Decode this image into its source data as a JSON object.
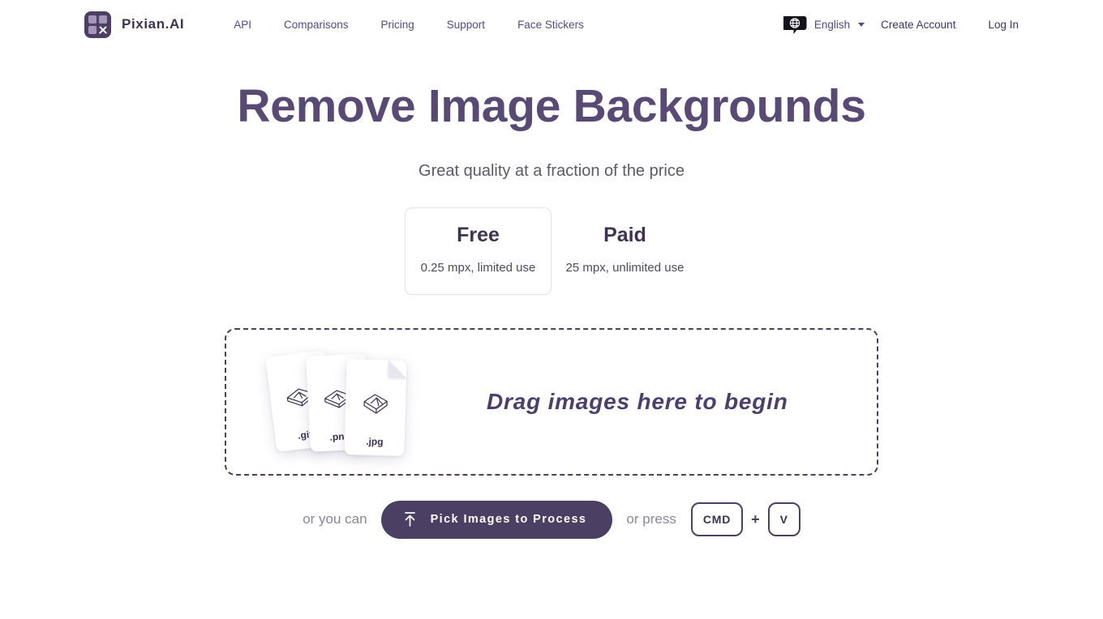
{
  "header": {
    "brand_name": "Pixian.AI",
    "logo_icon": "pixian-logo-icon",
    "nav": [
      {
        "label": "API"
      },
      {
        "label": "Comparisons"
      },
      {
        "label": "Pricing"
      },
      {
        "label": "Support"
      },
      {
        "label": "Face Stickers"
      }
    ],
    "language": {
      "icon": "globe-icon",
      "label": "English",
      "caret_icon": "chevron-down-icon"
    },
    "auth": [
      {
        "label": "Create Account"
      },
      {
        "label": "Log In"
      }
    ]
  },
  "hero": {
    "title": "Remove Image Backgrounds",
    "subtitle": "Great quality at a fraction of the price"
  },
  "tiers": [
    {
      "name": "Free",
      "desc": "0.25 mpx, limited use",
      "selected": true
    },
    {
      "name": "Paid",
      "desc": "25 mpx, unlimited use",
      "selected": false
    }
  ],
  "dropzone": {
    "message": "Drag images here to begin",
    "files": [
      {
        "ext": ".gif"
      },
      {
        "ext": ".png"
      },
      {
        "ext": ".jpg"
      }
    ]
  },
  "actions": {
    "hint_before": "or you can",
    "pick_button": "Pick Images to Process",
    "upload_icon": "upload-icon",
    "hint_after": "or press",
    "keys": [
      {
        "label": "CMD"
      },
      {
        "label": "V"
      }
    ],
    "plus": "+"
  },
  "colors": {
    "brand_purple": "#4b3f63",
    "heading_purple": "#584a75",
    "nav_link": "#514a8a",
    "muted": "#8b8794",
    "page_bg": "#ffffff"
  }
}
